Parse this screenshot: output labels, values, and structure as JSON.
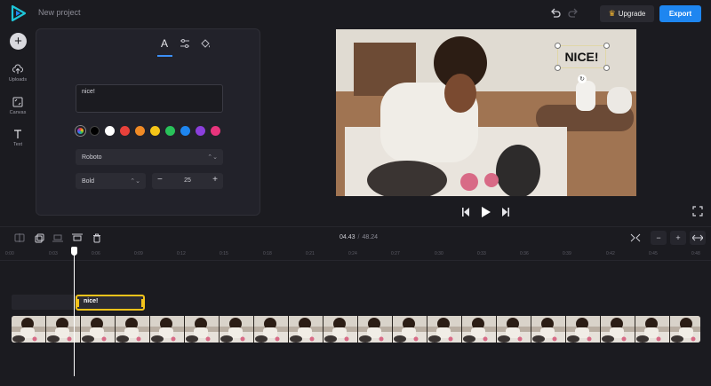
{
  "app": {
    "project_name": "New project",
    "upgrade_label": "Upgrade",
    "export_label": "Export",
    "accent": "#1e86f0"
  },
  "rail": {
    "items": [
      {
        "label": "Uploads",
        "icon": "upload-cloud-icon"
      },
      {
        "label": "Canvas",
        "icon": "canvas-icon"
      },
      {
        "label": "Text",
        "icon": "text-icon"
      }
    ]
  },
  "panel": {
    "tabs": [
      {
        "icon": "text-style-icon",
        "glyph": "A",
        "active": true
      },
      {
        "icon": "sliders-icon",
        "active": false
      },
      {
        "icon": "paint-bucket-icon",
        "active": false
      }
    ],
    "text_value": "nice!",
    "colors": [
      "#ffffff",
      "#000000",
      "#ffffff",
      "#e8413b",
      "#f08a25",
      "#f5c518",
      "#29c25a",
      "#1e86f0",
      "#8b3fdc",
      "#e8347c"
    ],
    "font_family": "Roboto",
    "font_weight": "Bold",
    "font_size": "25"
  },
  "preview": {
    "overlay_text": "NICE!"
  },
  "timeline": {
    "current_time": "04.43",
    "separator": "/",
    "total_time": "48.24",
    "ticks": [
      "0:00",
      "0:03",
      "0:06",
      "0:09",
      "0:12",
      "0:15",
      "0:18",
      "0:21",
      "0:24",
      "0:27",
      "0:30",
      "0:33",
      "0:36",
      "0:39",
      "0:42",
      "0:45",
      "0:48"
    ],
    "text_clip_label": "nice!",
    "highlight": "#f3c31b"
  }
}
